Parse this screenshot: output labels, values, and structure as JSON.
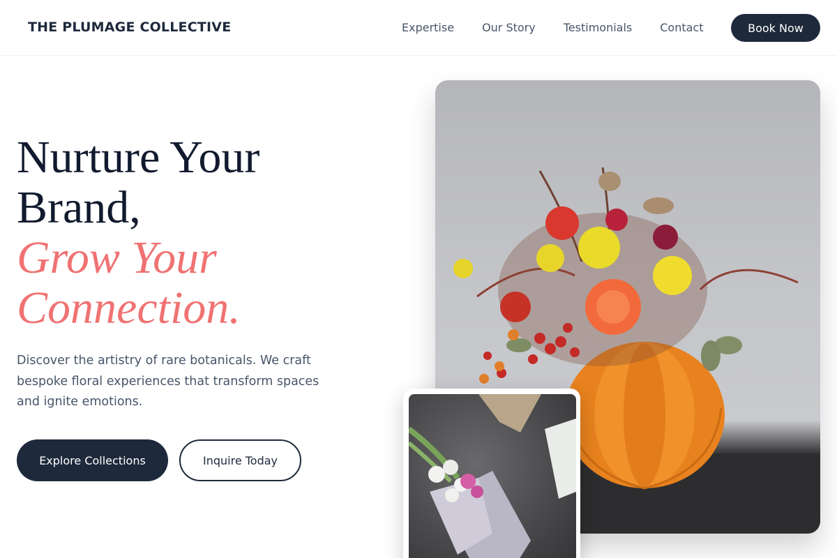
{
  "header": {
    "brand": "THE PLUMAGE COLLECTIVE",
    "nav": [
      "Expertise",
      "Our Story",
      "Testimonials",
      "Contact"
    ],
    "cta": "Book Now"
  },
  "hero": {
    "headline_line1": "Nurture Your",
    "headline_line2": "Brand,",
    "accent_line1": "Grow Your",
    "accent_line2": "Connection.",
    "description": "Discover the artistry of rare botanicals. We craft bespoke floral experiences that transform spaces and ignite emotions.",
    "primary_button": "Explore Collections",
    "secondary_button": "Inquire Today"
  },
  "images": {
    "main_alt": "Pumpkin vase floral arrangement",
    "secondary_alt": "Wrapped flower bouquet"
  },
  "colors": {
    "navy": "#1e293b",
    "accent": "#f07272",
    "body_text": "#475569"
  }
}
